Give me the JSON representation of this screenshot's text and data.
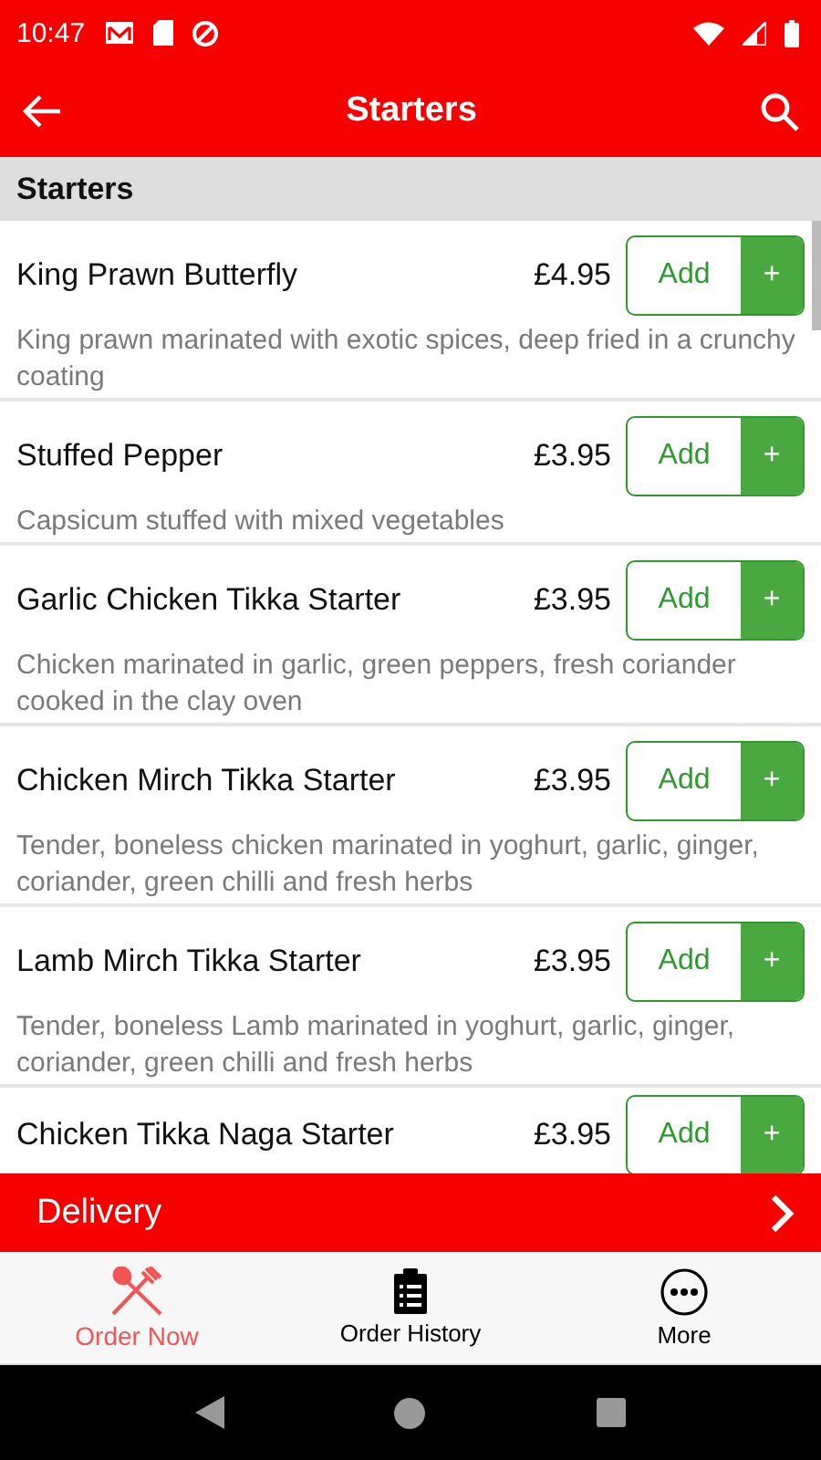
{
  "status_bar": {
    "time": "10:47"
  },
  "app_bar": {
    "title": "Starters"
  },
  "section": {
    "title": "Starters"
  },
  "items": [
    {
      "name": "King Prawn Butterfly",
      "price": "£4.95",
      "description": "King prawn marinated with exotic spices, deep fried in a crunchy coating",
      "add_label": "Add",
      "plus_label": "+"
    },
    {
      "name": "Stuffed Pepper",
      "price": "£3.95",
      "description": "Capsicum stuffed with mixed vegetables",
      "add_label": "Add",
      "plus_label": "+"
    },
    {
      "name": "Garlic Chicken Tikka Starter",
      "price": "£3.95",
      "description": "Chicken marinated in garlic, green peppers, fresh coriander cooked in the clay oven",
      "add_label": "Add",
      "plus_label": "+"
    },
    {
      "name": "Chicken Mirch Tikka Starter",
      "price": "£3.95",
      "description": "Tender, boneless chicken marinated in yoghurt, garlic, ginger, coriander, green chilli and fresh herbs",
      "add_label": "Add",
      "plus_label": "+"
    },
    {
      "name": "Lamb Mirch Tikka Starter",
      "price": "£3.95",
      "description": "Tender, boneless Lamb marinated in yoghurt, garlic, ginger, coriander, green chilli and fresh herbs",
      "add_label": "Add",
      "plus_label": "+"
    },
    {
      "name": "Chicken Tikka Naga Starter",
      "price": "£3.95",
      "add_label": "Add",
      "plus_label": "+"
    }
  ],
  "order_bar": {
    "label": "Delivery"
  },
  "tabs": [
    {
      "label": "Order Now",
      "selected": true
    },
    {
      "label": "Order History",
      "selected": false
    },
    {
      "label": "More",
      "selected": false
    }
  ]
}
